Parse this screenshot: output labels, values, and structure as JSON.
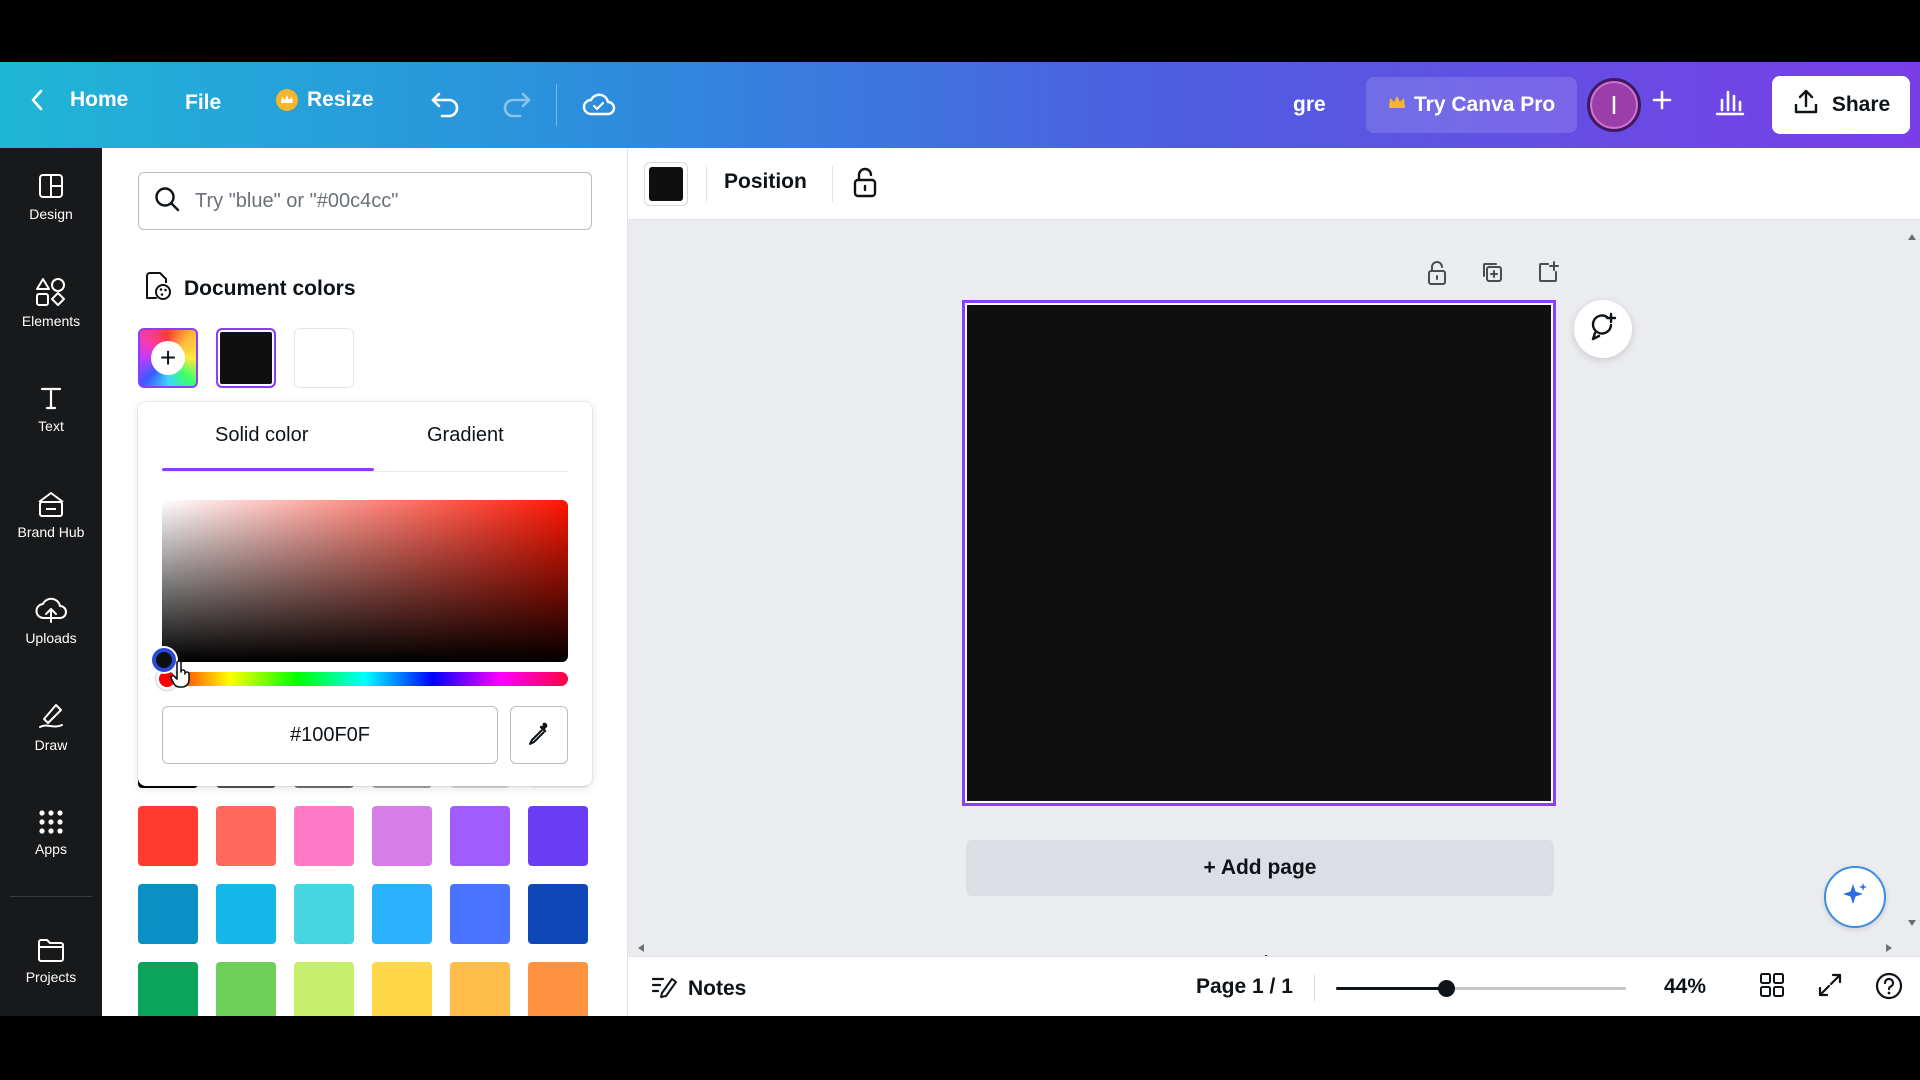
{
  "header": {
    "home_label": "Home",
    "file_label": "File",
    "resize_label": "Resize",
    "title": "gre",
    "pro_label": "Try Canva Pro",
    "avatar_initial": "I",
    "share_label": "Share"
  },
  "rail": {
    "items": [
      {
        "label": "Design",
        "icon": "design-icon"
      },
      {
        "label": "Elements",
        "icon": "elements-icon"
      },
      {
        "label": "Text",
        "icon": "text-icon"
      },
      {
        "label": "Brand Hub",
        "icon": "brand-hub-icon"
      },
      {
        "label": "Uploads",
        "icon": "uploads-icon"
      },
      {
        "label": "Draw",
        "icon": "draw-icon"
      },
      {
        "label": "Apps",
        "icon": "apps-icon"
      },
      {
        "label": "Projects",
        "icon": "projects-icon"
      }
    ]
  },
  "panel": {
    "search_placeholder": "Try \"blue\" or \"#00c4cc\"",
    "document_colors_title": "Document colors",
    "document_colors": [
      "#100f0f",
      "#ffffff"
    ],
    "picker": {
      "tab_solid": "Solid color",
      "tab_gradient": "Gradient",
      "active_tab": "Solid color",
      "hex_value": "#100F0F",
      "hue": 0
    },
    "default_colors": [
      [
        "#ff3b30",
        "#ff6a5c",
        "#ff7ac6",
        "#d77de8",
        "#a05cff",
        "#6a3df5"
      ],
      [
        "#0a90c2",
        "#13b7e9",
        "#45d6e2",
        "#2ab2ff",
        "#4a74ff",
        "#0d47b8"
      ],
      [
        "#0aa55a",
        "#6ccf58",
        "#c6f06c",
        "#ffd84a",
        "#ffbe4a",
        "#ff9340"
      ]
    ]
  },
  "toolbar": {
    "selected_color": "#100f0f",
    "position_label": "Position"
  },
  "canvas": {
    "page_color": "#100f0f",
    "add_page_label": "+ Add page"
  },
  "footer": {
    "notes_label": "Notes",
    "page_info": "Page 1 / 1",
    "zoom_label": "44%",
    "zoom_fraction": 0.38
  },
  "colors": {
    "accent": "#8b3dff",
    "rail_bg": "#18191b",
    "editor_bg": "#ebecf0"
  }
}
